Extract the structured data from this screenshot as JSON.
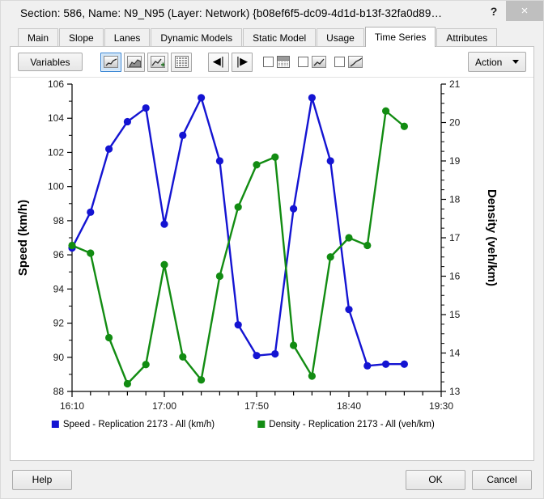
{
  "window": {
    "title": "Section: 586, Name: N9_N95 (Layer: Network) {b08ef6f5-dc09-4d1d-b13f-32fa0d89…",
    "help_button": "?",
    "close_button": "×"
  },
  "tabs": [
    {
      "label": "Main",
      "active": false
    },
    {
      "label": "Slope",
      "active": false
    },
    {
      "label": "Lanes",
      "active": false
    },
    {
      "label": "Dynamic Models",
      "active": false
    },
    {
      "label": "Static Model",
      "active": false
    },
    {
      "label": "Usage",
      "active": false
    },
    {
      "label": "Time Series",
      "active": true
    },
    {
      "label": "Attributes",
      "active": false
    }
  ],
  "toolbar": {
    "variables_label": "Variables",
    "action_label": "Action",
    "icons": [
      "line-chart-icon",
      "area-chart-icon",
      "add-chart-icon",
      "table-grid-icon",
      "first-frame-icon",
      "last-frame-icon",
      "calendar-icon",
      "trend-chart-icon",
      "cumulative-chart-icon"
    ]
  },
  "footer": {
    "help_label": "Help",
    "ok_label": "OK",
    "cancel_label": "Cancel"
  },
  "chart_data": {
    "type": "line",
    "title": "",
    "xlabel": "",
    "ylabel": "Speed (km/h)",
    "y2label": "Density (veh/km)",
    "x_tick_labels": [
      "16:10",
      "17:00",
      "17:50",
      "18:40",
      "19:30"
    ],
    "x_tick_values": [
      970,
      1020,
      1070,
      1120,
      1170
    ],
    "xlim": [
      970,
      1170
    ],
    "x_minor_tick_step": 10,
    "ylim": [
      88,
      106
    ],
    "y_ticks": [
      88,
      90,
      92,
      94,
      96,
      98,
      100,
      102,
      104,
      106
    ],
    "y2lim": [
      13,
      21
    ],
    "y2_ticks": [
      13,
      14,
      15,
      16,
      17,
      18,
      19,
      20,
      21
    ],
    "grid": false,
    "legend_position": "bottom",
    "x": [
      970,
      980,
      990,
      1000,
      1010,
      1020,
      1030,
      1040,
      1050,
      1060,
      1070,
      1080,
      1090,
      1100,
      1110,
      1120,
      1130,
      1140,
      1150
    ],
    "x_times": [
      "16:10",
      "16:20",
      "16:30",
      "16:40",
      "16:50",
      "17:00",
      "17:10",
      "17:20",
      "17:30",
      "17:40",
      "17:50",
      "18:00",
      "18:10",
      "18:20",
      "18:30",
      "18:40",
      "18:50",
      "19:00",
      "19:10"
    ],
    "series": [
      {
        "name": "Speed - Replication 2173 - All (km/h)",
        "color": "#1414d2",
        "axis": "left",
        "values": [
          96.4,
          98.5,
          102.2,
          103.8,
          104.6,
          97.8,
          103.0,
          105.2,
          101.5,
          91.9,
          90.1,
          90.2,
          98.7,
          105.2,
          101.5,
          92.8,
          89.5,
          89.6,
          89.6
        ]
      },
      {
        "name": "Density - Replication 2173 - All (veh/km)",
        "color": "#128c12",
        "axis": "right",
        "values": [
          16.8,
          16.6,
          14.4,
          13.2,
          13.7,
          16.3,
          13.9,
          13.3,
          16.0,
          17.8,
          18.9,
          19.1,
          14.2,
          13.4,
          16.5,
          17.0,
          16.8,
          20.3,
          19.9
        ]
      }
    ]
  }
}
